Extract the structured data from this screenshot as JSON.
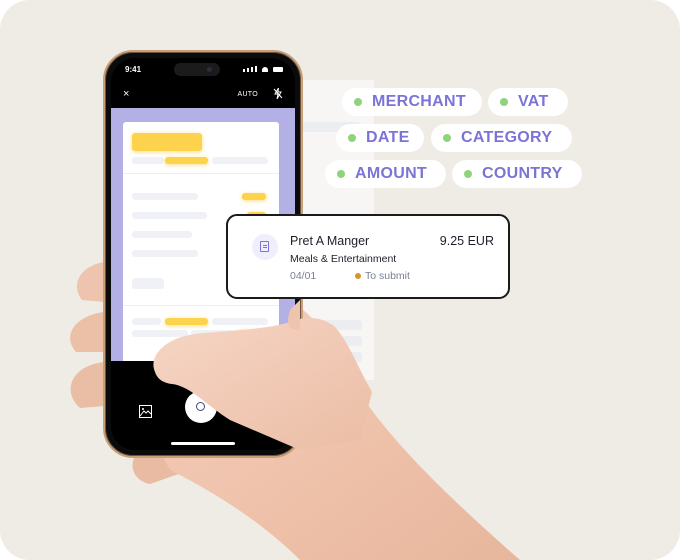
{
  "phone": {
    "status_time": "9:41",
    "top_bar": {
      "close_icon": "×",
      "mode_label": "AUTO",
      "flash_icon": "flash-off"
    },
    "bottom_bar": {
      "gallery_icon": "image",
      "shutter_icon": "circle"
    }
  },
  "extracted_fields": [
    {
      "label": "MERCHANT",
      "status_color": "#8fd47a"
    },
    {
      "label": "VAT",
      "status_color": "#8fd47a"
    },
    {
      "label": "DATE",
      "status_color": "#8fd47a"
    },
    {
      "label": "CATEGORY",
      "status_color": "#8fd47a"
    },
    {
      "label": "AMOUNT",
      "status_color": "#8fd47a"
    },
    {
      "label": "COUNTRY",
      "status_color": "#8fd47a"
    }
  ],
  "expense_card": {
    "merchant": "Pret A Manger",
    "amount": "9.25 EUR",
    "category": "Meals & Entertainment",
    "date": "04/01",
    "status": "To submit",
    "status_color": "#d8932c",
    "icon": "receipt"
  },
  "colors": {
    "accent": "#7b74d6",
    "viewfinder": "#b3b0e6",
    "highlight": "#fdd24d",
    "background": "#efebe5"
  }
}
